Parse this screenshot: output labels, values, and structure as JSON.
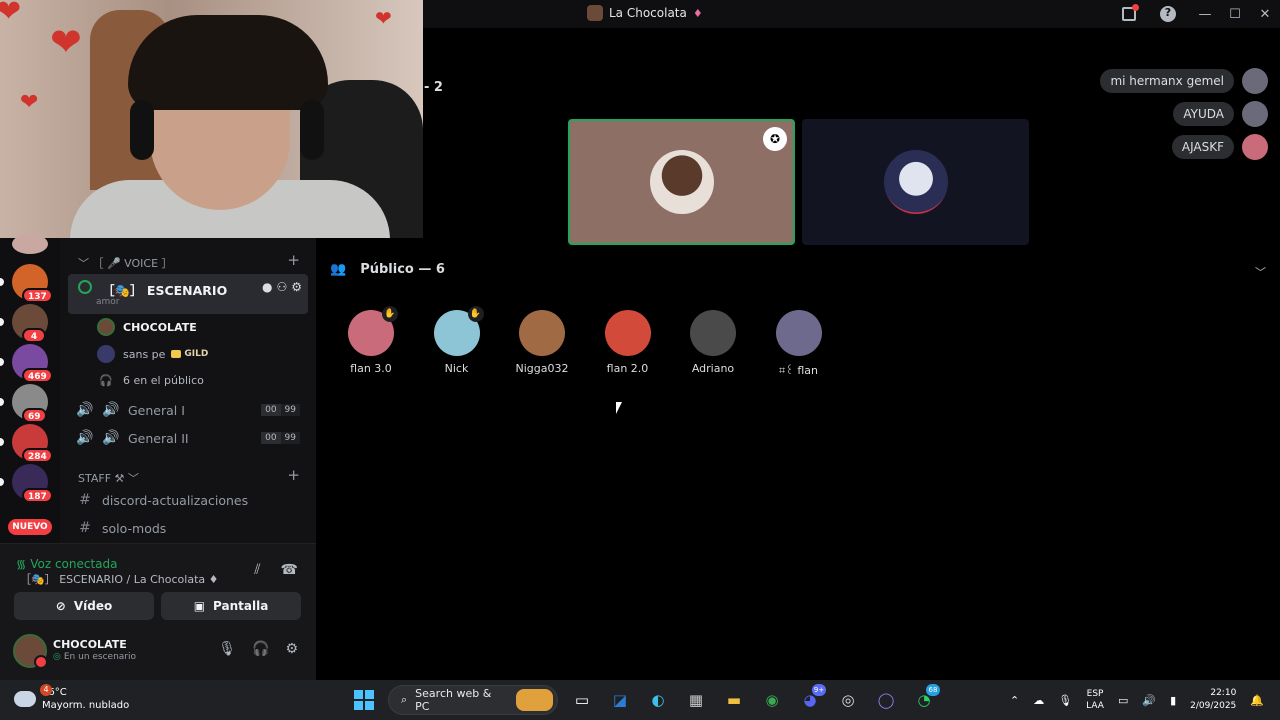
{
  "window": {
    "title": "La Chocolata",
    "title_gem": "♦"
  },
  "stage": {
    "speaker_count": "- 2",
    "audience_header": "Público — 6",
    "audience": [
      {
        "name": "flan 3.0",
        "color": "#c96b7a",
        "hand": true
      },
      {
        "name": "Nick",
        "color": "#8ec5d6",
        "hand": true
      },
      {
        "name": "Nigga032",
        "color": "#a06a45",
        "hand": false
      },
      {
        "name": "flan 2.0",
        "color": "#d24a3a",
        "hand": false
      },
      {
        "name": "Adriano",
        "color": "#4a4a4a",
        "hand": false
      },
      {
        "name": "⌗꒰ flan",
        "color": "#6d6a8e",
        "hand": false
      }
    ],
    "bubbles": [
      {
        "text": "mi hermanx gemel",
        "color": "#6b6a7a"
      },
      {
        "text": "AYUDA",
        "color": "#6b6a7a"
      },
      {
        "text": "AJASKF",
        "color": "#c96b7a"
      }
    ]
  },
  "servers": [
    {
      "badge": "137",
      "color": "#d2642a"
    },
    {
      "badge": "4",
      "color": "#6b4a3a"
    },
    {
      "badge": "469",
      "color": "#7a4aa0"
    },
    {
      "badge": "69",
      "color": "#8a8a8a"
    },
    {
      "badge": "284",
      "color": "#c93a3a"
    },
    {
      "badge": "187",
      "color": "#3a2a5a"
    }
  ],
  "nuevo_label": "NUEVO",
  "channels": {
    "voice_category": "﹀ ［ 🎤 VOICE ］",
    "stage_channel": "［🎭］ ESCENARIO",
    "stage_sub": "amor",
    "members": [
      {
        "name": "CHOCOLATE",
        "color": "#6b4a3a"
      },
      {
        "name": "sans pe",
        "color": "#3a3a6a"
      }
    ],
    "gild_label": "GILD",
    "audience_count": "6 en el público",
    "voice_channels": [
      {
        "name": "General I",
        "l1": "00",
        "l2": "99"
      },
      {
        "name": "General II",
        "l1": "00",
        "l2": "99"
      }
    ],
    "staff_category": "STAFF ⚒ ﹀",
    "text_channels": [
      "discord-actualizaciones",
      "solo-mods"
    ]
  },
  "voice_panel": {
    "status": "Voz conectada",
    "where": "［🎭］ ESCENARIO / La Chocolata ♦",
    "video_label": "Vídeo",
    "screen_label": "Pantalla"
  },
  "user": {
    "name": "CHOCOLATE",
    "status": "En un escenario"
  },
  "taskbar": {
    "temp": "16°C",
    "weather": "Mayorm. nublado",
    "weather_badge": "4",
    "search_placeholder": "Search web & PC",
    "discord_badge": "9+",
    "whatsapp_badge": "68",
    "lang1": "ESP",
    "lang2": "LAA",
    "time": "22:10",
    "date": "2/09/2025"
  }
}
